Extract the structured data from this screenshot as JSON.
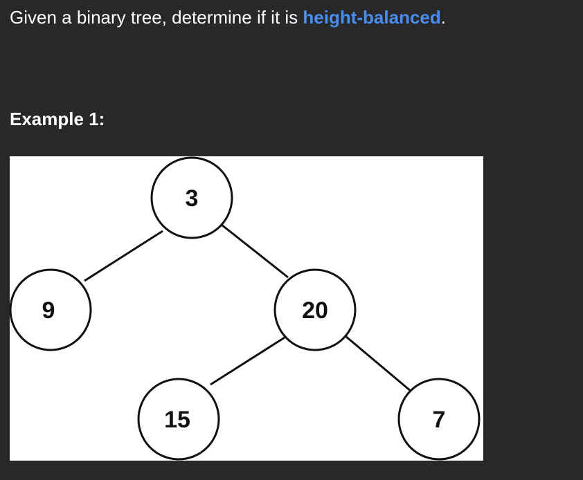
{
  "problem": {
    "text_before": "Given a binary tree, determine if it is ",
    "keyword": "height-balanced",
    "text_after": ".",
    "keyword_color": "#4a8df0"
  },
  "example": {
    "heading": "Example 1:"
  },
  "tree": {
    "nodes": [
      "3",
      "9",
      "20",
      "15",
      "7"
    ],
    "edges": [
      [
        "3",
        "9"
      ],
      [
        "3",
        "20"
      ],
      [
        "20",
        "15"
      ],
      [
        "20",
        "7"
      ]
    ]
  }
}
